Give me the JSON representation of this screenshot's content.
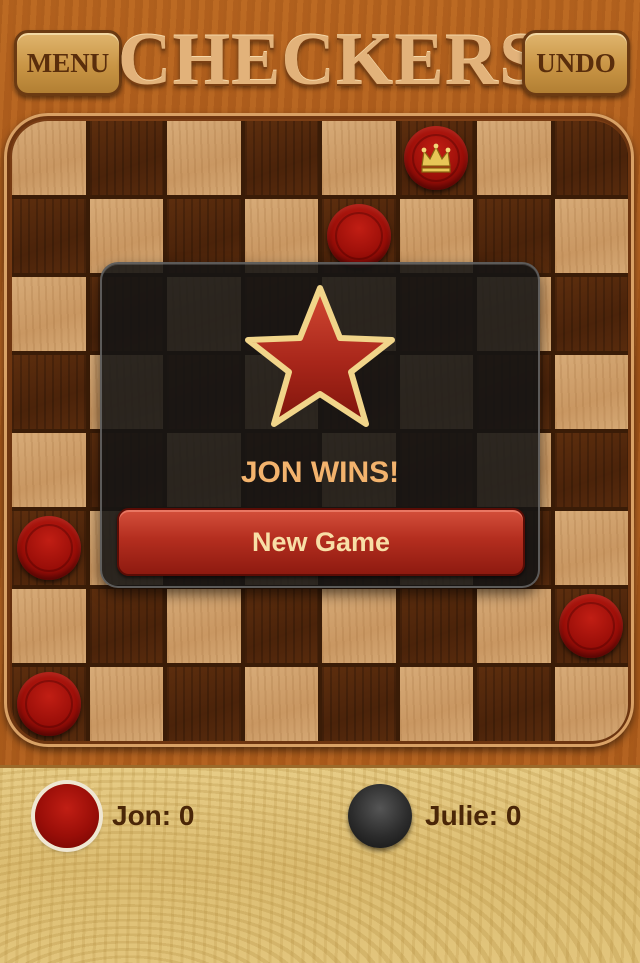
{
  "header": {
    "menu_label": "MENU",
    "title": "CHECKERS",
    "undo_label": "UNDO"
  },
  "board": {
    "rows": 8,
    "cols": 8,
    "pieces": [
      {
        "row": 0,
        "col": 5,
        "color": "red",
        "king": true
      },
      {
        "row": 1,
        "col": 4,
        "color": "red",
        "king": false
      },
      {
        "row": 5,
        "col": 0,
        "color": "red",
        "king": false
      },
      {
        "row": 6,
        "col": 7,
        "color": "red",
        "king": false
      },
      {
        "row": 7,
        "col": 0,
        "color": "red",
        "king": false
      }
    ]
  },
  "dialog": {
    "icon": "star-icon",
    "message": "JON WINS!",
    "button_label": "New Game"
  },
  "scores": {
    "player1": {
      "label": "Jon: 0",
      "color": "red"
    },
    "player2": {
      "label": "Julie: 0",
      "color": "black"
    }
  },
  "colors": {
    "red_piece": "#9a0e08",
    "black_piece": "#2c2c2c",
    "win_text": "#f3b36d",
    "button_red": "#b42e1f"
  }
}
